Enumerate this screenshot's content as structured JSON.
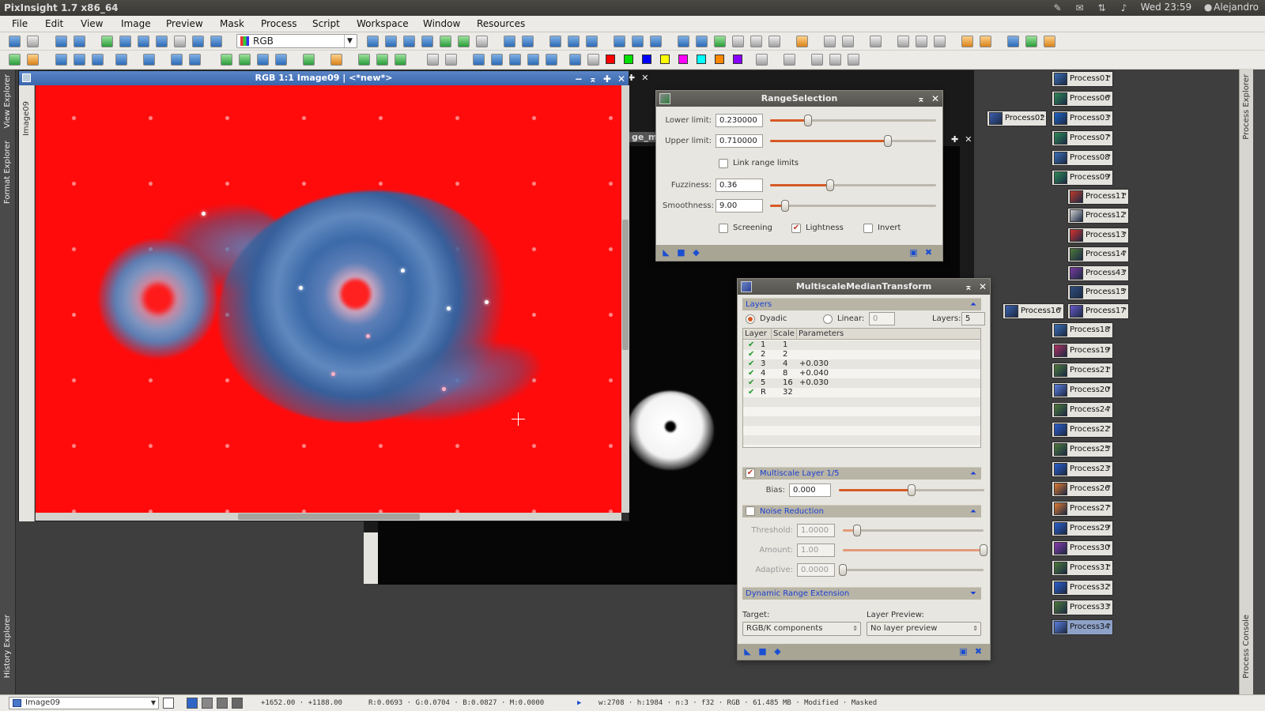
{
  "system_bar": {
    "app_title": "PixInsight 1.7 x86_64",
    "clock": "Wed 23:59",
    "user": "Alejandro",
    "icons": [
      "edit-icon",
      "mail-icon",
      "network-icon",
      "volume-icon",
      "user-icon"
    ]
  },
  "menu": {
    "items": [
      "File",
      "Edit",
      "View",
      "Image",
      "Preview",
      "Mask",
      "Process",
      "Script",
      "Workspace",
      "Window",
      "Resources"
    ]
  },
  "toolbar": {
    "color_space_select": "RGB"
  },
  "left_dock": {
    "tabs": [
      "View Explorer",
      "Format Explorer",
      "History Explorer"
    ]
  },
  "right_dock": {
    "tabs": [
      "Process Explorer",
      "Process Console"
    ]
  },
  "image_window": {
    "title": "RGB 1:1 Image09 | <*new*>",
    "side_tab": "Image09",
    "buttons": [
      "−",
      "⌅",
      "✚",
      "✕"
    ]
  },
  "mask_window": {
    "title_fragment": "ge_ma"
  },
  "range_selection": {
    "title": "RangeSelection",
    "lower_limit_label": "Lower limit:",
    "lower_limit": "0.230000",
    "lower_limit_value": 0.23,
    "upper_limit_label": "Upper limit:",
    "upper_limit": "0.710000",
    "upper_limit_value": 0.71,
    "link_label": "Link range limits",
    "link_checked": false,
    "fuzziness_label": "Fuzziness:",
    "fuzziness": "0.36",
    "fuzziness_value": 0.36,
    "smoothness_label": "Smoothness:",
    "smoothness": "9.00",
    "smoothness_value": 0.09,
    "screening_label": "Screening",
    "screening_checked": false,
    "lightness_label": "Lightness",
    "lightness_checked": true,
    "invert_label": "Invert",
    "invert_checked": false
  },
  "mmt": {
    "title": "MultiscaleMedianTransform",
    "layers_section": "Layers",
    "dyadic_label": "Dyadic",
    "linear_label": "Linear:",
    "linear_value": "0",
    "layers_label": "Layers:",
    "layers_value": "5",
    "table_headers": [
      "Layer",
      "Scale",
      "Parameters"
    ],
    "table_rows": [
      {
        "check": "✔",
        "layer": "1",
        "scale": "1",
        "params": ""
      },
      {
        "check": "✔",
        "layer": "2",
        "scale": "2",
        "params": ""
      },
      {
        "check": "✔",
        "layer": "3",
        "scale": "4",
        "params": "+0.030"
      },
      {
        "check": "✔",
        "layer": "4",
        "scale": "8",
        "params": "+0.040"
      },
      {
        "check": "✔",
        "layer": "5",
        "scale": "16",
        "params": "+0.030"
      },
      {
        "check": "✔",
        "layer": "R",
        "scale": "32",
        "params": ""
      }
    ],
    "multiscale_section": "Multiscale Layer 1/5",
    "bias_label": "Bias:",
    "bias": "0.000",
    "bias_value": 0.5,
    "noise_section": "Noise Reduction",
    "threshold_label": "Threshold:",
    "threshold": "1.0000",
    "threshold_value": 0.1,
    "amount_label": "Amount:",
    "amount": "1.00",
    "amount_value": 1.0,
    "adaptive_label": "Adaptive:",
    "adaptive": "0.0000",
    "adaptive_value": 0.0,
    "dre_section": "Dynamic Range Extension",
    "target_label": "Target:",
    "target_value": "RGB/K components",
    "preview_label": "Layer Preview:",
    "preview_value": "No layer preview"
  },
  "process_icons": [
    {
      "label": "Process01",
      "color": "#3a6fb5"
    },
    {
      "label": "Process06",
      "color": "#2e8b57"
    },
    {
      "label": "Process03",
      "color": "#1e64c8"
    },
    {
      "label": "Process02",
      "color": "#3b5fb0"
    },
    {
      "label": "Process07",
      "color": "#2e8b57"
    },
    {
      "label": "Process08",
      "color": "#3a6fb5"
    },
    {
      "label": "Process09",
      "color": "#2e8b57"
    },
    {
      "label": "Process11",
      "color": "#c03a2b"
    },
    {
      "label": "Process12",
      "color": "#d0d0d0"
    },
    {
      "label": "Process13",
      "color": "#d9302b"
    },
    {
      "label": "Process14",
      "color": "#4d7a3a"
    },
    {
      "label": "Process43",
      "color": "#7a3aa0"
    },
    {
      "label": "Process15",
      "color": "#2f4f7f"
    },
    {
      "label": "Process16",
      "color": "#3b62b0"
    },
    {
      "label": "Process17",
      "color": "#6a5acd"
    },
    {
      "label": "Process18",
      "color": "#3a6fb5"
    },
    {
      "label": "Process19",
      "color": "#b03060"
    },
    {
      "label": "Process21",
      "color": "#4d7a3a"
    },
    {
      "label": "Process20",
      "color": "#5b7ee0"
    },
    {
      "label": "Process24",
      "color": "#4d7a3a"
    },
    {
      "label": "Process22",
      "color": "#2a5fd0"
    },
    {
      "label": "Process25",
      "color": "#4d7a3a"
    },
    {
      "label": "Process23",
      "color": "#2a5fd0"
    },
    {
      "label": "Process26",
      "color": "#e07a30"
    },
    {
      "label": "Process27",
      "color": "#e07a30"
    },
    {
      "label": "Process29",
      "color": "#2a5fd0"
    },
    {
      "label": "Process30",
      "color": "#8a3ab0"
    },
    {
      "label": "Process31",
      "color": "#4d7a3a"
    },
    {
      "label": "Process32",
      "color": "#2a5fd0"
    },
    {
      "label": "Process33",
      "color": "#4d7a3a"
    },
    {
      "label": "Process34",
      "color": "#5b7ee0"
    }
  ],
  "status_bar": {
    "view": "Image09",
    "coords": "+1652.00 · +1188.00",
    "values": "R:0.0693 · G:0.0704 · B:0.0827 · M:0.0000",
    "info": "w:2708 · h:1984 · n:3 · f32 · RGB · 61.485 MB · Modified · Masked"
  }
}
